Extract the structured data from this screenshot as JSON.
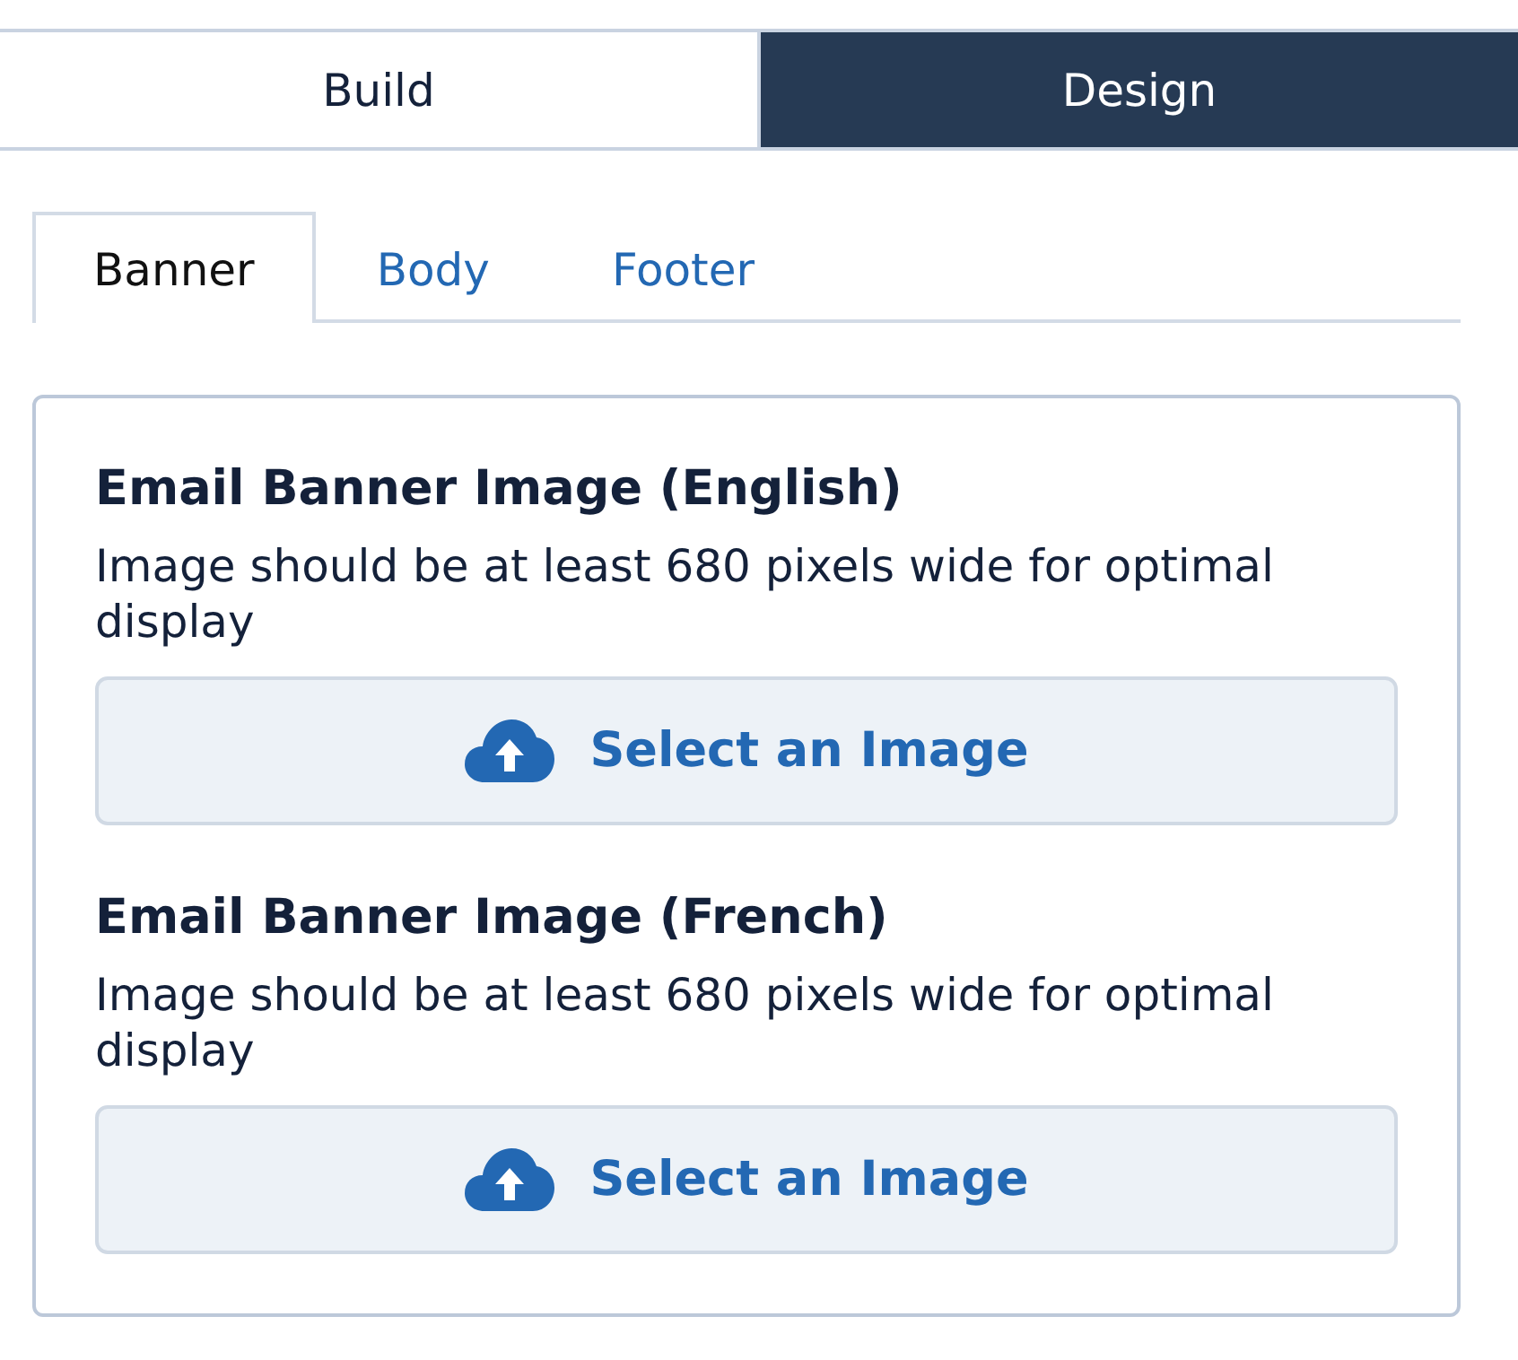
{
  "mode_tabs": [
    {
      "label": "Build",
      "selected": false
    },
    {
      "label": "Design",
      "selected": true
    }
  ],
  "section_tabs": [
    {
      "label": "Banner",
      "selected": true
    },
    {
      "label": "Body",
      "selected": false
    },
    {
      "label": "Footer",
      "selected": false
    }
  ],
  "panel": {
    "fields": [
      {
        "title": "Email Banner Image (English)",
        "hint": "Image should be at least 680 pixels wide for optimal display",
        "button": "Select an Image"
      },
      {
        "title": "Email Banner Image (French)",
        "hint": "Image should be at least 680 pixels wide for optimal display",
        "button": "Select an Image"
      }
    ]
  }
}
